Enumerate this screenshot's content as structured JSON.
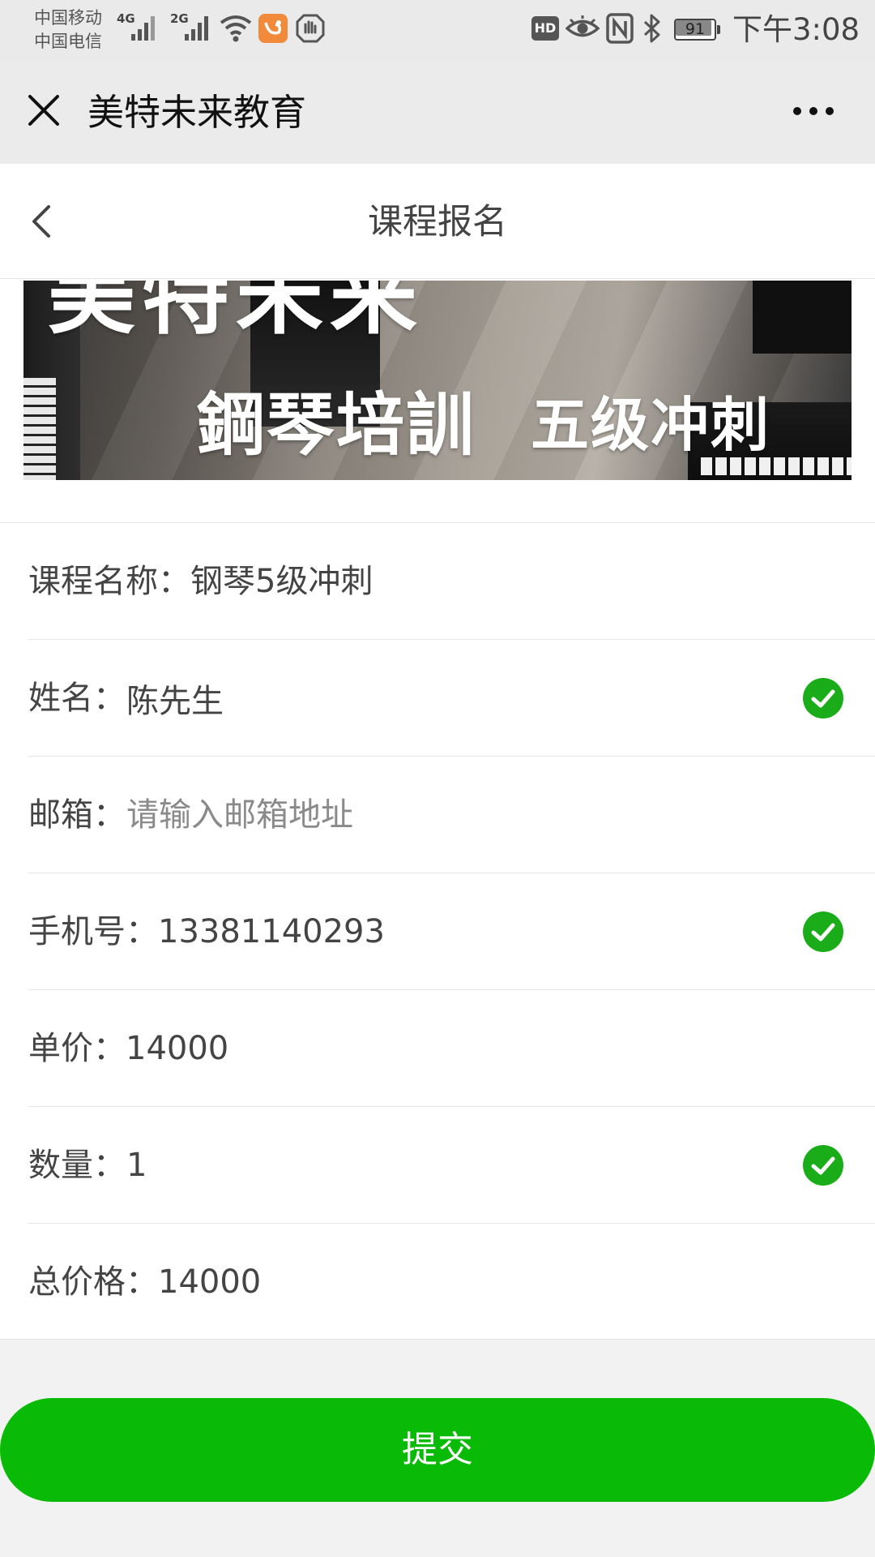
{
  "status_bar": {
    "carrier1": "中国移动",
    "carrier2": "中国电信",
    "net1": "4G",
    "net2": "2G",
    "hd": "HD",
    "battery": "91",
    "battery_level": 0.91,
    "time": "下午3:08"
  },
  "wechat_bar": {
    "title": "美特未来教育"
  },
  "header": {
    "title": "课程报名"
  },
  "banner": {
    "line1": "美特未来",
    "line2": "鋼琴培訓",
    "line3": "五级冲刺"
  },
  "form": {
    "course": {
      "label": "课程名称：",
      "value": "钢琴5级冲刺"
    },
    "name": {
      "label": "姓名：",
      "value": "陈先生",
      "valid": true
    },
    "email": {
      "label": "邮箱：",
      "value": "",
      "placeholder": "请输入邮箱地址"
    },
    "phone": {
      "label": "手机号：",
      "value": "13381140293",
      "valid": true
    },
    "price": {
      "label": "单价：",
      "value": "14000"
    },
    "quantity": {
      "label": "数量：",
      "value": "1",
      "valid": true
    },
    "total": {
      "label": "总价格：",
      "value": "14000"
    }
  },
  "submit": {
    "label": "提交"
  },
  "colors": {
    "accent_green": "#09bb07",
    "valid_green": "#1aad19"
  }
}
